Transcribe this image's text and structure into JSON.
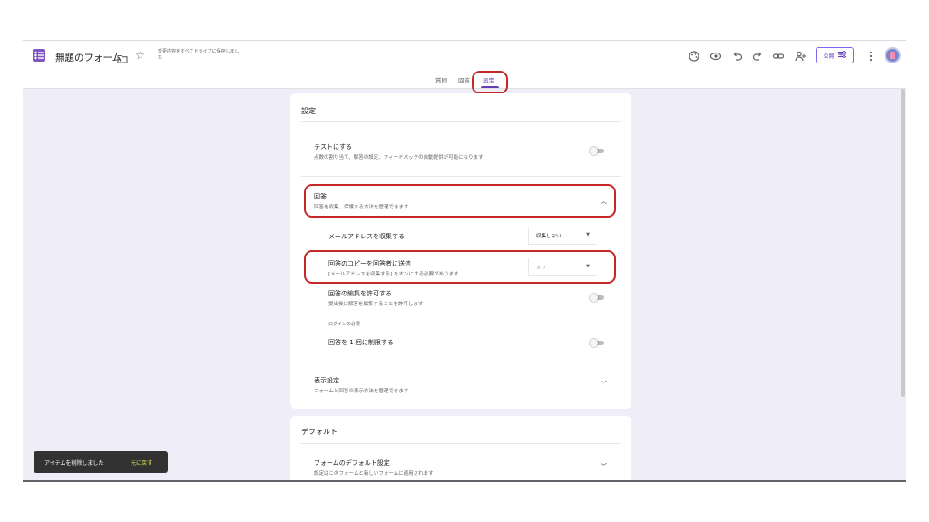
{
  "header": {
    "title": "無題のフォーム",
    "save_status": "変更内容をすべてドライブに保存しました",
    "publish_label": "公開",
    "icons": [
      "palette-icon",
      "preview-icon",
      "undo-icon",
      "redo-icon",
      "link-icon",
      "add-collaborator-icon",
      "more-icon"
    ]
  },
  "tabs": [
    {
      "label": "質問",
      "active": false
    },
    {
      "label": "回答",
      "active": false
    },
    {
      "label": "設定",
      "active": true
    }
  ],
  "settings_card": {
    "heading": "設定",
    "quiz": {
      "title": "テストにする",
      "desc": "点数の割り当て、解答の設定、フィードバックの自動提供が可能になります",
      "on": false
    },
    "responses": {
      "title": "回答",
      "desc": "回答を収集、保護する方法を管理できます",
      "expanded": true
    },
    "collect_email": {
      "title": "メールアドレスを収集する",
      "value": "収集しない"
    },
    "send_copy": {
      "title": "回答のコピーを回答者に送信",
      "desc": "[メールアドレスを収集する] をオンにする必要があります",
      "value": "オフ"
    },
    "allow_edit": {
      "title": "回答の編集を許可する",
      "desc": "提出後に解答を編集することを許可します",
      "on": false
    },
    "login_required_label": "ログインの必要",
    "limit_one": {
      "title": "回答を 1 回に制限する",
      "on": false
    },
    "presentation": {
      "title": "表示設定",
      "desc": "フォームと回答の表示方法を管理できます",
      "expanded": false
    }
  },
  "defaults_card": {
    "heading": "デフォルト",
    "form_defaults": {
      "title": "フォームのデフォルト設定",
      "desc": "設定はこのフォームと新しいフォームに適用されます"
    }
  },
  "toast": {
    "message": "アイテムを削除しました",
    "undo_label": "元に戻す"
  },
  "colors": {
    "accent": "#673ab7",
    "background": "#efedf8",
    "highlight": "#c62828"
  }
}
